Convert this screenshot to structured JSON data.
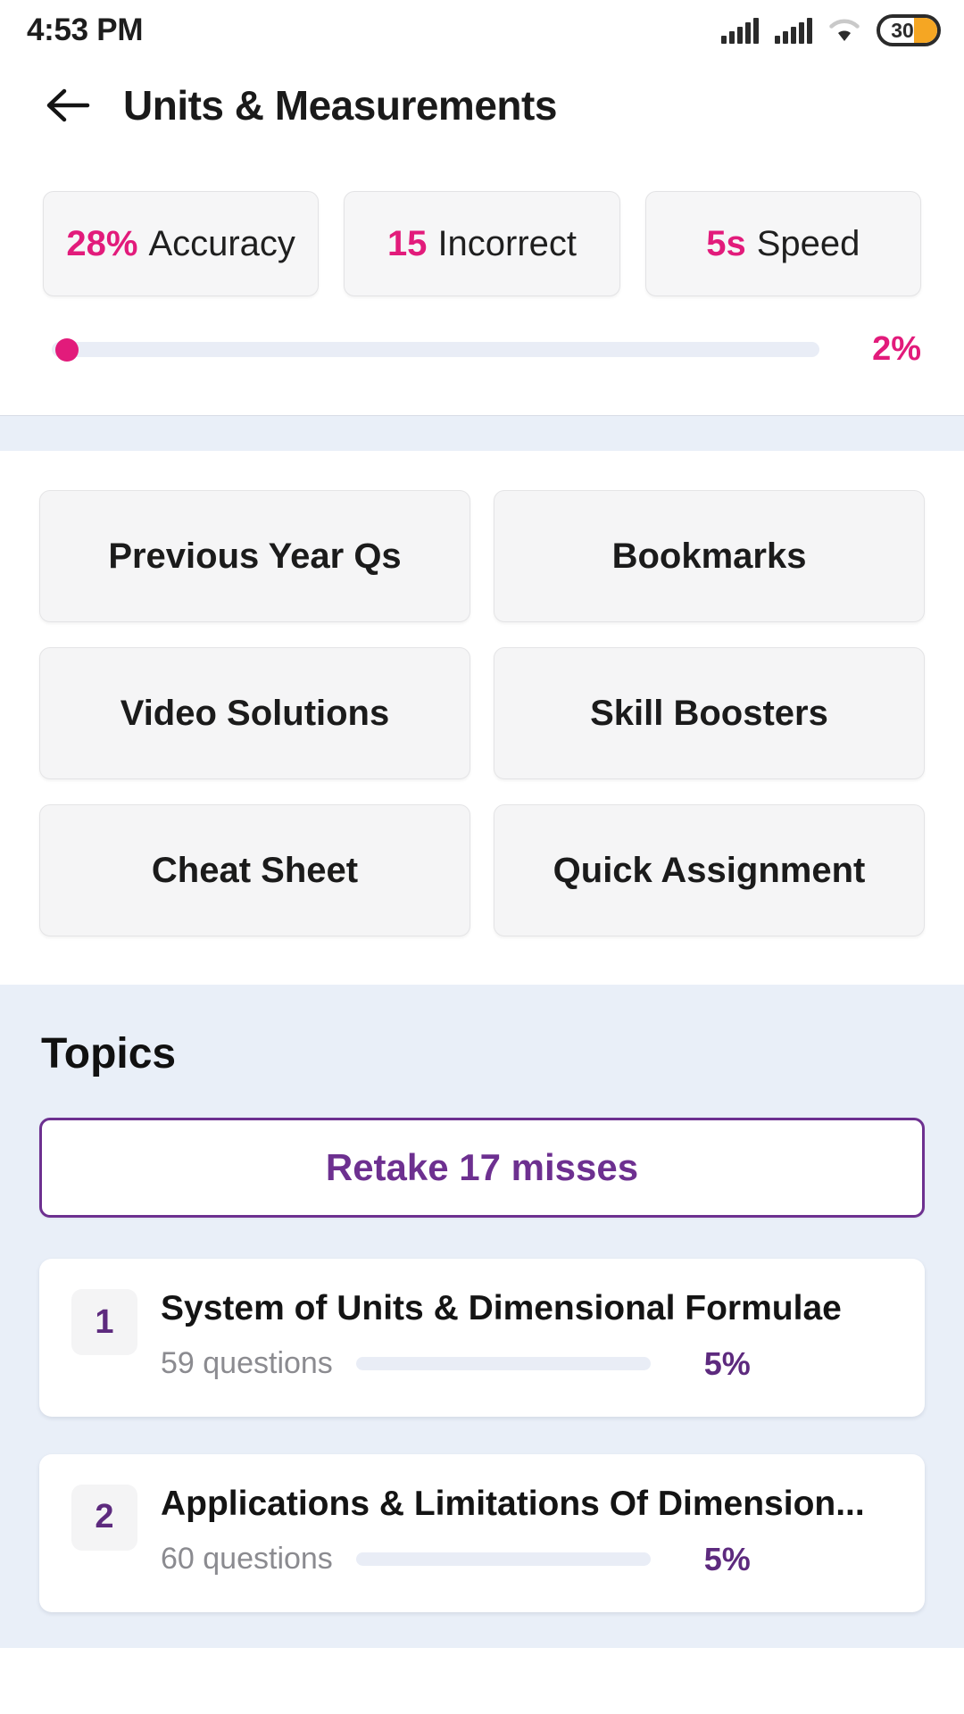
{
  "status_bar": {
    "time": "4:53 PM",
    "battery_level": "30",
    "icons": [
      "signal-icon",
      "signal-icon",
      "wifi-icon",
      "battery-icon"
    ]
  },
  "header": {
    "back_icon": "arrow-left-icon",
    "title": "Units & Measurements"
  },
  "summary": {
    "stats": [
      {
        "value": "28%",
        "label": "Accuracy"
      },
      {
        "value": "15",
        "label": "Incorrect"
      },
      {
        "value": "5s",
        "label": "Speed"
      }
    ],
    "progress": {
      "percent_label": "2%",
      "percent_value": 2
    }
  },
  "actions": [
    {
      "label": "Previous Year Qs"
    },
    {
      "label": "Bookmarks"
    },
    {
      "label": "Video Solutions"
    },
    {
      "label": "Skill Boosters"
    },
    {
      "label": "Cheat Sheet"
    },
    {
      "label": "Quick Assignment"
    }
  ],
  "topics_section": {
    "heading": "Topics",
    "retake_label": "Retake 17 misses",
    "items": [
      {
        "number": "1",
        "name": "System of Units & Dimensional Formulae",
        "questions": "59 questions",
        "percent_label": "5%",
        "percent_value": 5
      },
      {
        "number": "2",
        "name": "Applications & Limitations Of Dimension...",
        "questions": "60 questions",
        "percent_label": "5%",
        "percent_value": 5
      }
    ]
  },
  "colors": {
    "accent_pink": "#e21b7b",
    "accent_purple": "#5d2a7e",
    "section_blue": "#e9eff8",
    "card_gray": "#f5f5f6"
  }
}
